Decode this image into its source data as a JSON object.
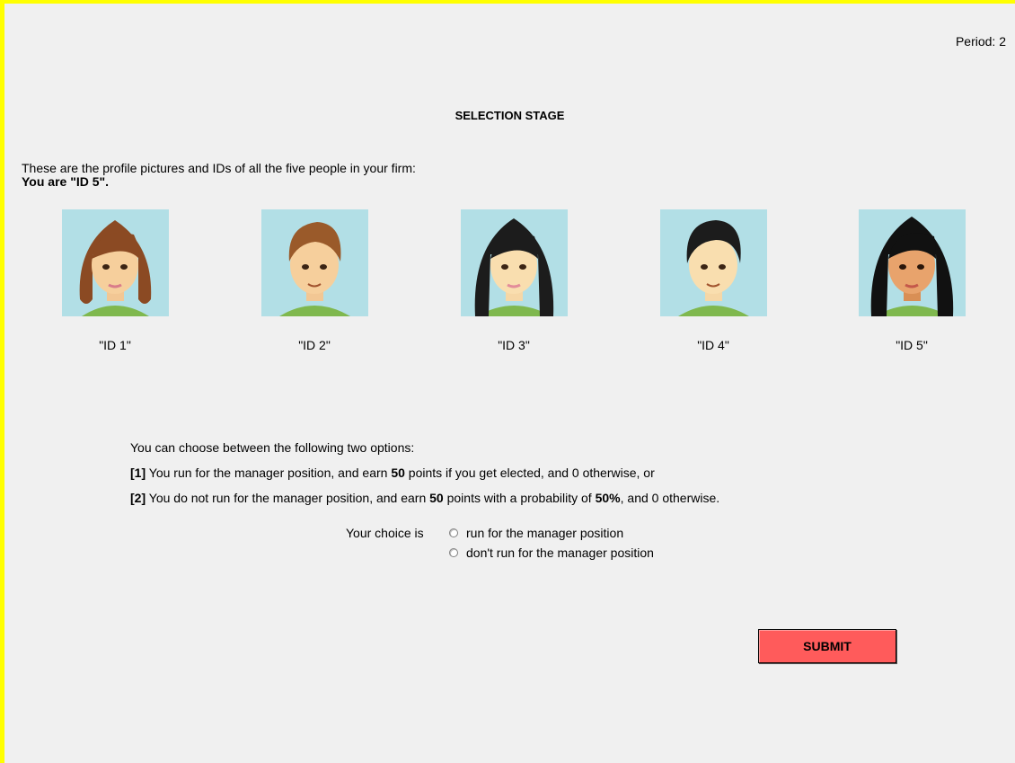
{
  "header": {
    "period_text": "Period: 2"
  },
  "stage": {
    "title": "SELECTION STAGE"
  },
  "intro": {
    "line1": "These are the profile pictures and IDs of all the five people in your firm:",
    "line2": "You are \"ID 5\"."
  },
  "people": [
    {
      "label": "\"ID 1\"",
      "hair": "brown",
      "gender": "female"
    },
    {
      "label": "\"ID 2\"",
      "hair": "brown",
      "gender": "male"
    },
    {
      "label": "\"ID 3\"",
      "hair": "black",
      "gender": "female"
    },
    {
      "label": "\"ID 4\"",
      "hair": "black",
      "gender": "male"
    },
    {
      "label": "\"ID 5\"",
      "hair": "black",
      "gender": "female"
    }
  ],
  "options": {
    "intro": "You can choose between the following two options:",
    "opt1_num": "[1]",
    "opt1_a": " You run for the manager position, and earn ",
    "opt1_points": "50",
    "opt1_b": " points if you get elected, and 0 otherwise, or",
    "opt2_num": "[2]",
    "opt2_a": " You do not run for the manager position, and earn ",
    "opt2_points": "50",
    "opt2_b": " points with a probability of ",
    "opt2_prob": "50%",
    "opt2_c": ", and 0 otherwise."
  },
  "choice": {
    "label": "Your choice is",
    "run": "run for the manager position",
    "dont_run": "don't run for the manager position"
  },
  "submit": {
    "label": "SUBMIT"
  },
  "colors": {
    "frame": "#ffff00",
    "background": "#f0f0f0",
    "avatar_bg": "#b2dfe6",
    "shirt": "#7fb84e",
    "submit": "#ff5b5b"
  }
}
